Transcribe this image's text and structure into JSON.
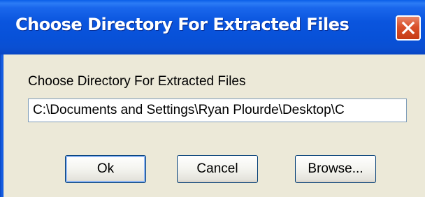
{
  "window": {
    "title": "Choose Directory For Extracted Files"
  },
  "dialog": {
    "label": "Choose Directory For Extracted Files",
    "directory_value": "C:\\Documents and Settings\\Ryan Plourde\\Desktop\\C"
  },
  "buttons": {
    "ok_label": "Ok",
    "cancel_label": "Cancel",
    "browse_label": "Browse..."
  },
  "icons": {
    "close": "close-icon"
  },
  "colors": {
    "titlebar": "#0a55de",
    "window_face": "#ece9d8",
    "close_button": "#d9502a"
  }
}
